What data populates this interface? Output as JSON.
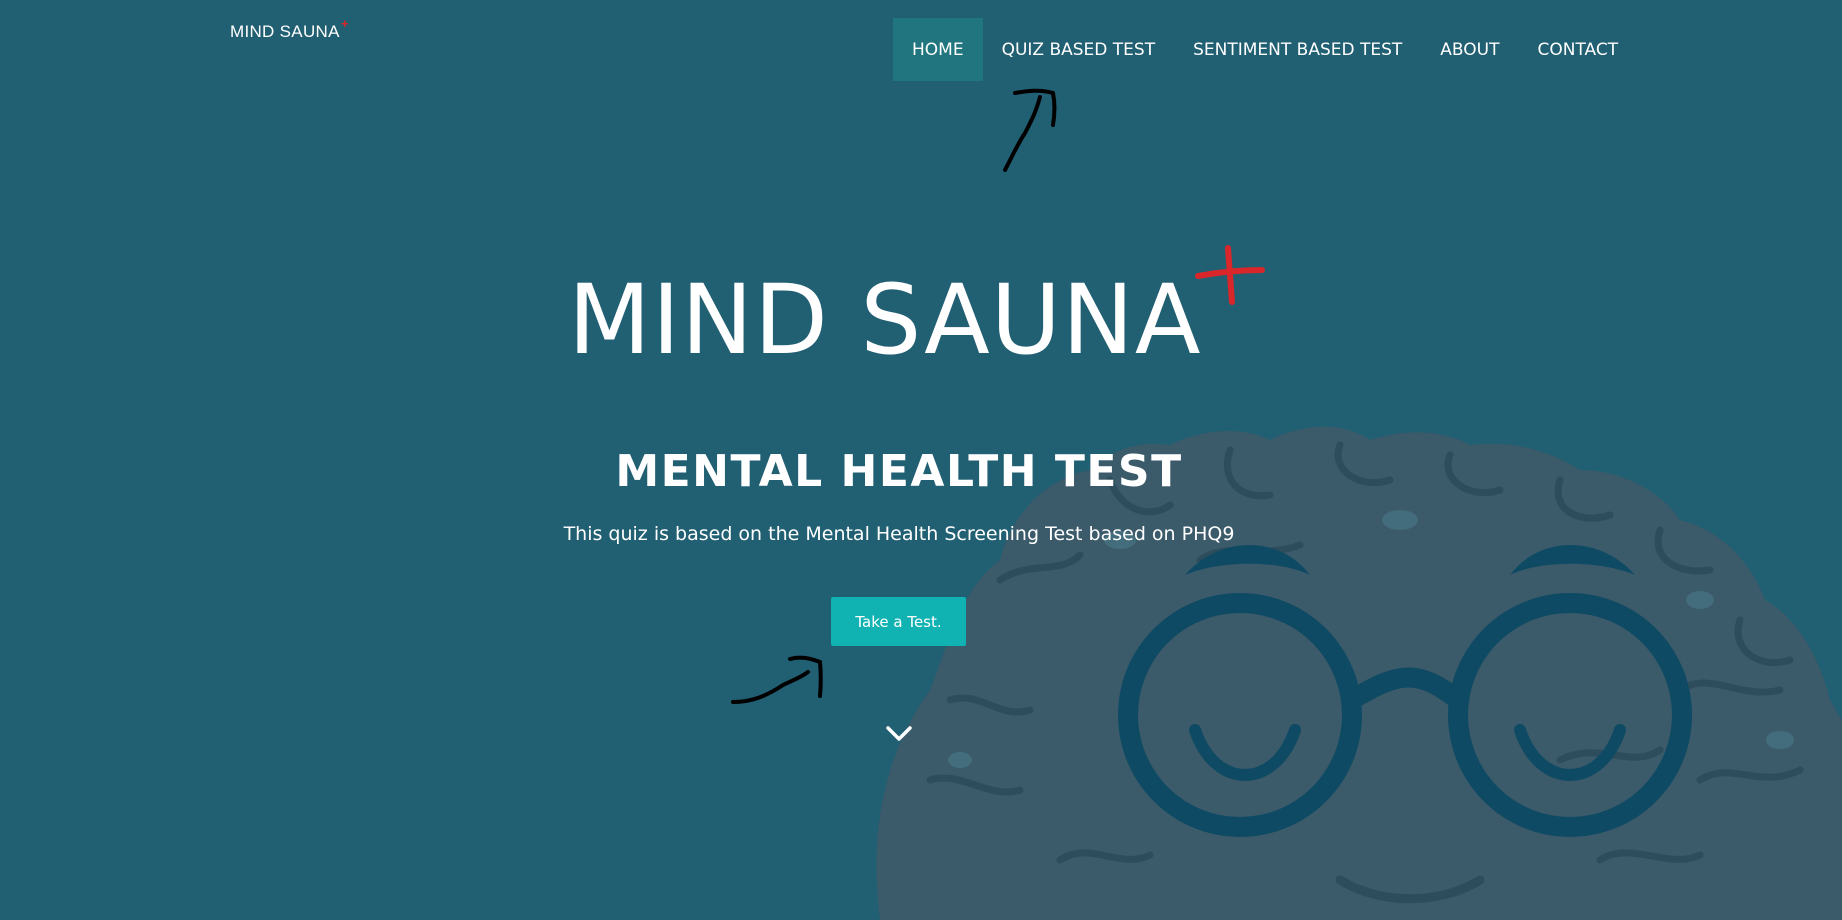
{
  "brand": {
    "name": "MIND SAUNA",
    "plus": "+"
  },
  "nav": {
    "items": [
      {
        "label": "HOME",
        "active": true
      },
      {
        "label": "QUIZ BASED TEST",
        "active": false
      },
      {
        "label": "SENTIMENT BASED TEST",
        "active": false
      },
      {
        "label": "ABOUT",
        "active": false
      },
      {
        "label": "CONTACT",
        "active": false
      }
    ]
  },
  "hero": {
    "logo_text": "MIND SAUNA",
    "title": "MENTAL HEALTH TEST",
    "subtitle": "This quiz is based on the Mental Health Screening Test based on PHQ9",
    "cta_label": "Take a Test."
  },
  "icons": {
    "scroll": "chevron-down-icon",
    "logo_plus": "red-plus-icon"
  },
  "colors": {
    "background": "#215f72",
    "nav_active": "#21757f",
    "cta": "#11b2b2",
    "accent_red": "#d8262b",
    "brain": "#3b5a6a",
    "glasses": "#0e4a63"
  }
}
